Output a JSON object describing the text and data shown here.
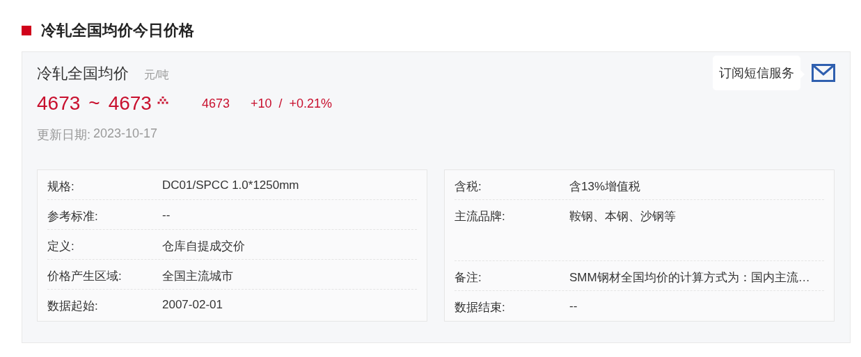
{
  "section_title": "冷轧全国均价今日价格",
  "card": {
    "name": "冷轧全国均价",
    "unit": "元/吨",
    "subscribe_tip": "订阅短信服务",
    "price_low": "4673",
    "range_sep": "~",
    "price_high": "4673",
    "rising": true,
    "average": "4673",
    "change": "+10",
    "change_sep": "/",
    "change_pct": "+0.21%",
    "update_label": "更新日期:",
    "update_date": "2023-10-17"
  },
  "left_table": [
    {
      "label": "规格:",
      "value": "DC01/SPCC 1.0*1250mm"
    },
    {
      "label": "参考标准:",
      "value": "--"
    },
    {
      "label": "定义:",
      "value": "仓库自提成交价"
    },
    {
      "label": "价格产生区域:",
      "value": "全国主流城市"
    },
    {
      "label": "数据起始:",
      "value": "2007-02-01"
    }
  ],
  "right_table": [
    {
      "label": "含税:",
      "value": "含13%增值税"
    },
    {
      "label": "主流品牌:",
      "value": "鞍钢、本钢、沙钢等",
      "kind": "tall"
    },
    {
      "label": "备注:",
      "value": "SMM钢材全国均价的计算方式为：国内主流…"
    },
    {
      "label": "数据结束:",
      "value": "--"
    }
  ]
}
